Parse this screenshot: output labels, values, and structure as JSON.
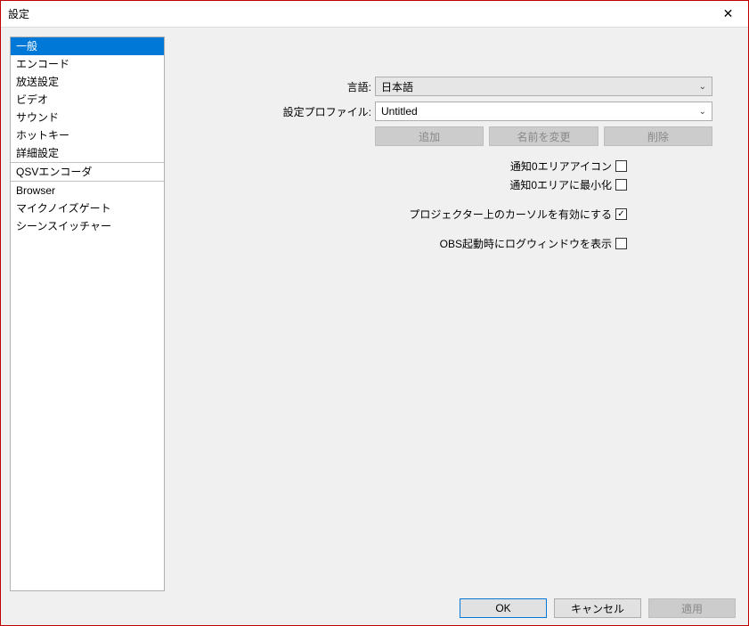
{
  "title": "設定",
  "sidebar": {
    "items": [
      {
        "label": "一般",
        "selected": true
      },
      {
        "label": "エンコード"
      },
      {
        "label": "放送設定"
      },
      {
        "label": "ビデオ"
      },
      {
        "label": "サウンド"
      },
      {
        "label": "ホットキー"
      },
      {
        "label": "詳細設定"
      },
      {
        "label": "QSVエンコーダ",
        "sep": true
      },
      {
        "label": "Browser",
        "sep": true
      },
      {
        "label": "マイクノイズゲート"
      },
      {
        "label": "シーンスイッチャー"
      }
    ]
  },
  "form": {
    "language_label": "言語:",
    "language_value": "日本語",
    "profile_label": "設定プロファイル:",
    "profile_value": "Untitled",
    "buttons": {
      "add": "追加",
      "rename": "名前を変更",
      "delete": "削除"
    },
    "checks": {
      "tray_icon": "通知0エリアアイコン",
      "minimize_tray": "通知0エリアに最小化",
      "projector_cursor": "プロジェクター上のカーソルを有効にする",
      "log_window": "OBS起動時にログウィンドウを表示"
    },
    "check_values": {
      "tray_icon": false,
      "minimize_tray": false,
      "projector_cursor": true,
      "log_window": false
    }
  },
  "footer": {
    "ok": "OK",
    "cancel": "キャンセル",
    "apply": "適用"
  }
}
